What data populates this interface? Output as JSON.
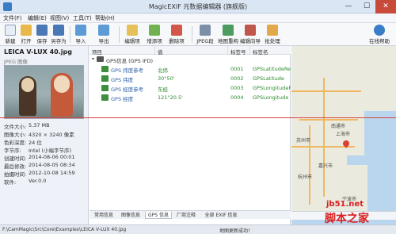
{
  "window": {
    "title": "MagicEXIF 元数据编辑器 (旗舰版)",
    "min_glyph": "—",
    "max_glyph": "☐",
    "close_glyph": "✕"
  },
  "menu": [
    "文件(F)",
    "编辑(E)",
    "视图(V)",
    "工具(T)",
    "帮助(H)"
  ],
  "toolbar": {
    "new": "新建",
    "open": "打开",
    "save": "保存",
    "save_as": "另存为",
    "import": "导入",
    "export": "导出",
    "edit_item": "编辑项",
    "add_item": "增添项",
    "delete_item": "删除项",
    "jpeg_seg": "JPEG段",
    "map_relocate": "地图重构",
    "edit_wizard": "编辑向导",
    "batch": "批处理",
    "online_help": "在线帮助"
  },
  "left_panel": {
    "file_name": "LEICA V-LUX 40.jpg",
    "file_type": "JPEG 图像",
    "info": [
      {
        "key": "文件大小:",
        "value": "5.37 MB"
      },
      {
        "key": "图像大小:",
        "value": "4320 × 3240 像素"
      },
      {
        "key": "色彩深度:",
        "value": "24 位"
      },
      {
        "key": "字节序:",
        "value": "Intel (小端字节序)"
      },
      {
        "key": "创建时间:",
        "value": "2014-08-06 00:01"
      },
      {
        "key": "最后修改:",
        "value": "2014-08-05 08:34"
      },
      {
        "key": "拍摄时间:",
        "value": "2012-10-08 14:59"
      },
      {
        "key": "软件:",
        "value": "Ver.0.0"
      }
    ]
  },
  "table": {
    "columns": [
      "项目",
      "值",
      "标签号",
      "标签名"
    ],
    "group": "GPS信息 (GPS IFD)",
    "rows": [
      {
        "item": "GPS 纬度参考",
        "value": "北纬",
        "tag": "0001",
        "name": "GPSLatitudeRef"
      },
      {
        "item": "GPS 纬度",
        "value": "30°50'",
        "tag": "0002",
        "name": "GPSLatitude"
      },
      {
        "item": "GPS 经度参考",
        "value": "东经",
        "tag": "0003",
        "name": "GPSLongitudeRef"
      },
      {
        "item": "GPS 经度",
        "value": "121°20.5'",
        "tag": "0004",
        "name": "GPSLongitude"
      }
    ]
  },
  "tabs": [
    "常用信息",
    "图像信息",
    "GPS 信息",
    "厂商注释",
    "全部 EXIF 信息"
  ],
  "active_tab": "GPS 信息",
  "map": {
    "labels": [
      "南通市",
      "上海市",
      "苏州市",
      "杭州市",
      "嘉兴市",
      "宁波市"
    ]
  },
  "status": {
    "path": "F:\\CamMagic\\Src\\Core\\Examples\\LEICA V-LUX 40.jpg",
    "map_text": "地图更新成功！"
  },
  "watermark": {
    "line1": "jb51.net",
    "line2": "脚本之家"
  },
  "colors": {
    "accent": "#3a7cc6",
    "green_text": "#2e8b2e",
    "red_line": "#d8413a",
    "watermark": "#d82020"
  }
}
